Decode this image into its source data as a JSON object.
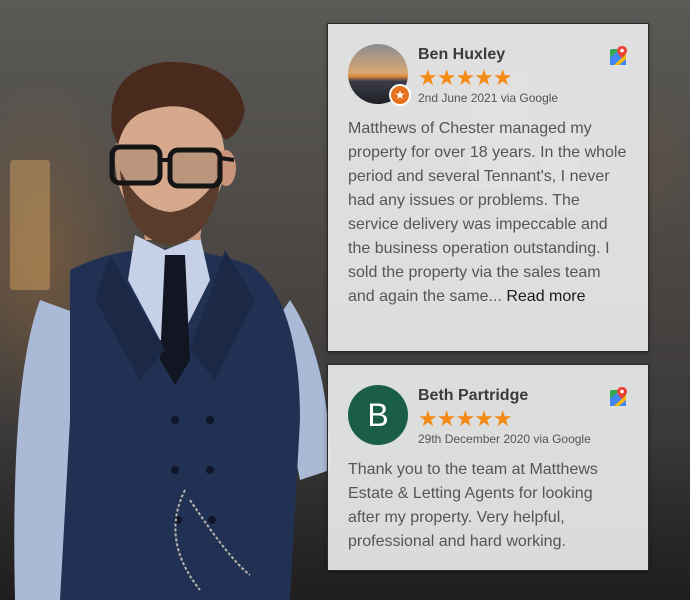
{
  "reviews": [
    {
      "name": "Ben Huxley",
      "stars": "★★★★★",
      "date": "2nd June 2021 via Google",
      "text": "Matthews of Chester managed my property for over 18 years. In the whole period and several Tennant's, I never had any issues or problems. The service delivery was impeccable and the business operation outstanding. I sold the property via the sales team and again the same...",
      "read_more": "Read more",
      "avatar_badge": "★"
    },
    {
      "name": "Beth Partridge",
      "avatar_letter": "B",
      "stars": "★★★★★",
      "date": "29th December 2020 via Google",
      "text": "Thank you to the team at Matthews Estate & Letting Agents for looking after my property. Very helpful, professional and hard working."
    }
  ],
  "colors": {
    "star": "#f58b16",
    "avatar_bg": "#1a5e4a",
    "badge": "#e6721c"
  },
  "icons": [
    "google-maps-icon",
    "local-guide-badge-icon"
  ]
}
